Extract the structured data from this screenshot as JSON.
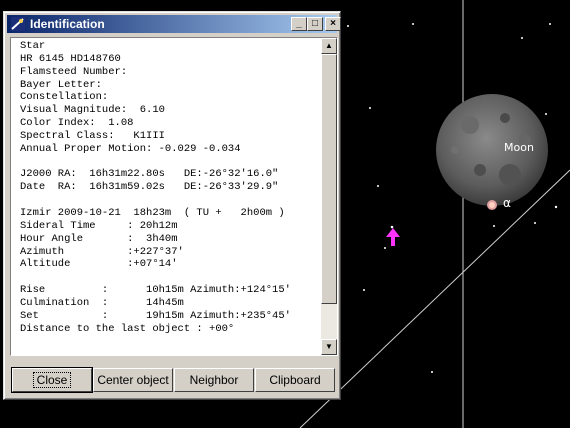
{
  "window": {
    "title": "Identification",
    "controls": {
      "minimize": "_",
      "maximize": "□",
      "close": "×"
    }
  },
  "info_lines": [
    "Star",
    "HR 6145 HD148760",
    "Flamsteed Number:",
    "Bayer Letter:",
    "Constellation:",
    "Visual Magnitude:  6.10",
    "Color Index:  1.08",
    "Spectral Class:   K1III",
    "Annual Proper Motion: -0.029 -0.034",
    "",
    "J2000 RA:  16h31m22.80s   DE:-26°32'16.0\"",
    "Date  RA:  16h31m59.02s   DE:-26°33'29.9\"",
    "",
    "Izmir 2009-10-21  18h23m  ( TU +   2h00m )",
    "Sideral Time     : 20h12m",
    "Hour Angle       :  3h40m",
    "Azimuth          :+227°37'",
    "Altitude         :+07°14'",
    "",
    "Rise         :      10h15m Azimuth:+124°15'",
    "Culmination  :      14h45m",
    "Set          :      19h15m Azimuth:+235°45'",
    "Distance to the last object : +00°"
  ],
  "buttons": {
    "close": "Close",
    "center": "Center object",
    "neighbor": "Neighbor",
    "clipboard": "Clipboard"
  },
  "sky": {
    "moon_label": "Moon",
    "alpha_label": "α",
    "marker_color": "#ff33ff"
  }
}
